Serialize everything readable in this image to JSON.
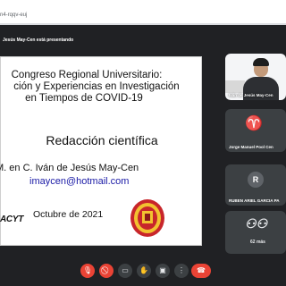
{
  "browser": {
    "url": "n4-rqqv-euj"
  },
  "meeting": {
    "banner": "Jesús May-Cen está presentando"
  },
  "slide": {
    "title_lines": [
      "Congreso Regional Universitario:",
      "ción y Experiencias en Investigación",
      "en Tiempos de COVID-19"
    ],
    "subtitle": "Redacción científica",
    "author": "M. en C. Iván de Jesús May-Cen",
    "email": "imaycen@hotmail.com",
    "logo_text": "ACYT",
    "date": "Octubre de 2021"
  },
  "participants": [
    {
      "name": "Iván de Jesús May-Cen",
      "type": "video"
    },
    {
      "name": "Jorge Manuel Pool Cen",
      "type": "logo"
    },
    {
      "name": "RUBEN ARIEL GARCIA PA",
      "type": "avatar",
      "initial": "R"
    },
    {
      "name": "",
      "type": "more",
      "more_label": "62 más"
    }
  ],
  "controls": [
    {
      "icon": "mic-off-icon",
      "glyph": "🎙"
    },
    {
      "icon": "camera-off-icon",
      "glyph": "⃠"
    },
    {
      "icon": "captions-icon",
      "glyph": "▭"
    },
    {
      "icon": "raise-hand-icon",
      "glyph": "✋"
    },
    {
      "icon": "present-screen-icon",
      "glyph": "▣"
    },
    {
      "icon": "more-options-icon",
      "glyph": "⋮"
    },
    {
      "icon": "end-call-icon",
      "glyph": "☎"
    }
  ]
}
